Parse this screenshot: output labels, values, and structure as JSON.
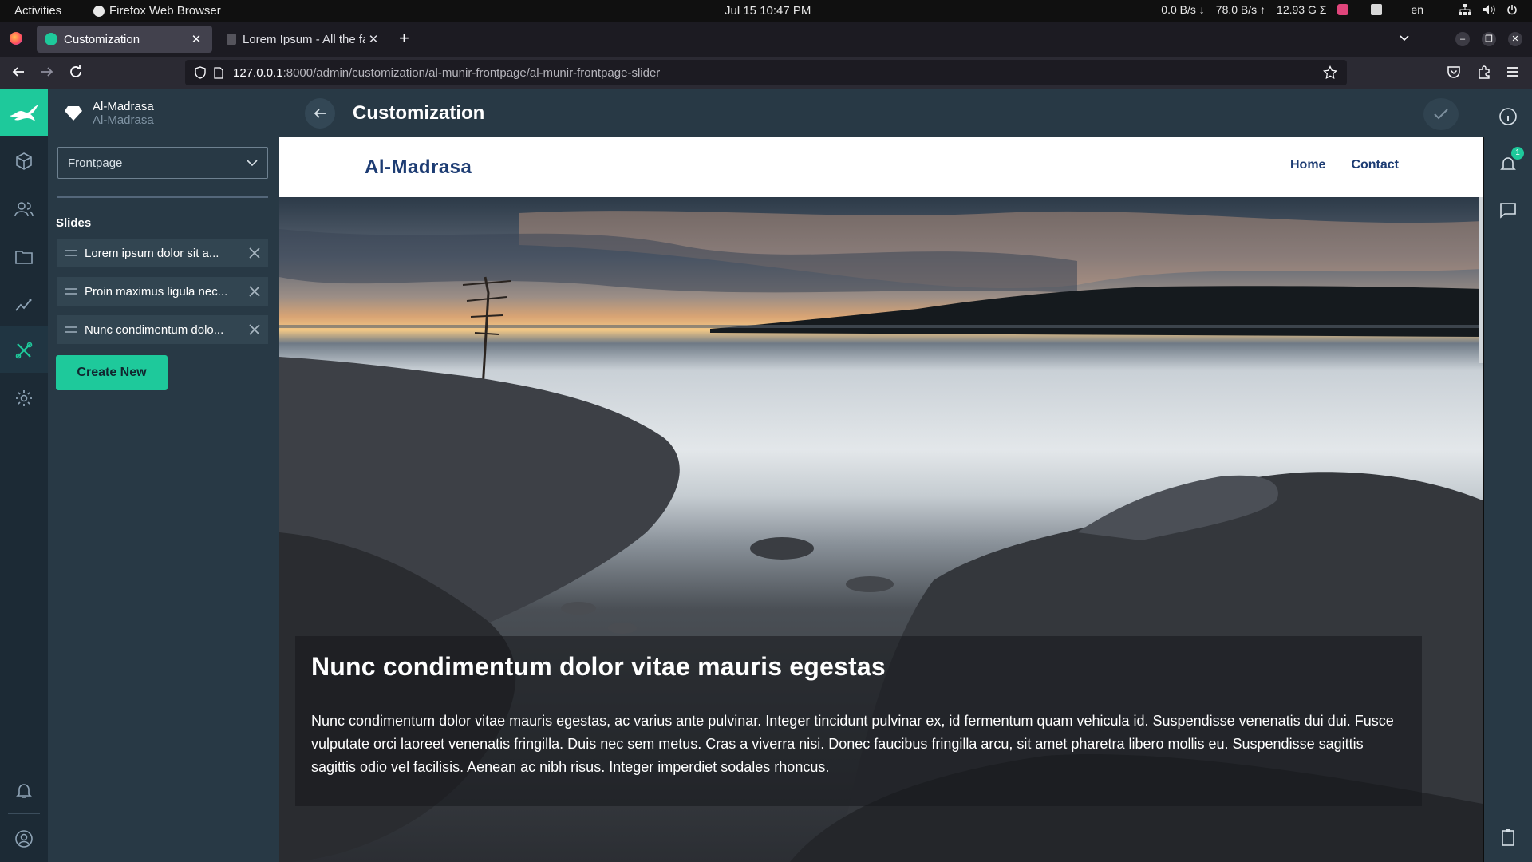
{
  "topbar": {
    "activities": "Activities",
    "app_name": "Firefox Web Browser",
    "clock": "Jul 15  10:47 PM",
    "net_down": "0.0 B/s",
    "net_up": "78.0 B/s",
    "mem": "12.93 G",
    "lang": "en"
  },
  "browser": {
    "tabs": [
      {
        "label": "Customization"
      },
      {
        "label": "Lorem Ipsum - All the fac"
      }
    ],
    "url_host": "127.0.0.1",
    "url_path": ":8000/admin/customization/al-munir-frontpage/al-munir-frontpage-slider"
  },
  "panel": {
    "site_name": "Al-Madrasa",
    "site_subtitle": "Al-Madrasa",
    "page_select": "Frontpage",
    "slides_label": "Slides",
    "slides": [
      {
        "label": "Lorem ipsum dolor sit a..."
      },
      {
        "label": "Proin maximus ligula nec..."
      },
      {
        "label": "Nunc condimentum dolo..."
      }
    ],
    "create_label": "Create New"
  },
  "main": {
    "title": "Customization"
  },
  "preview": {
    "brand": "Al-Madrasa",
    "nav_links": [
      {
        "label": "Home"
      },
      {
        "label": "Contact"
      }
    ],
    "caption_title": "Nunc condimentum dolor vitae mauris egestas",
    "caption_text": "Nunc condimentum dolor vitae mauris egestas, ac varius ante pulvinar. Integer tincidunt pulvinar ex, id fermentum quam vehicula id. Suspendisse venenatis dui dui. Fusce vulputate orci laoreet venenatis fringilla. Duis nec sem metus. Cras a viverra nisi. Donec faucibus fringilla arcu, sit amet pharetra libero mollis eu. Suspendisse sagittis sagittis odio vel facilisis. Aenean ac nibh risus. Integer imperdiet sodales rhoncus."
  },
  "rightrail": {
    "notification_count": "1"
  },
  "colors": {
    "accent": "#1ec99b",
    "sidebar": "#283945",
    "rail": "#1c2a35",
    "brand_text": "#1d3c73"
  }
}
